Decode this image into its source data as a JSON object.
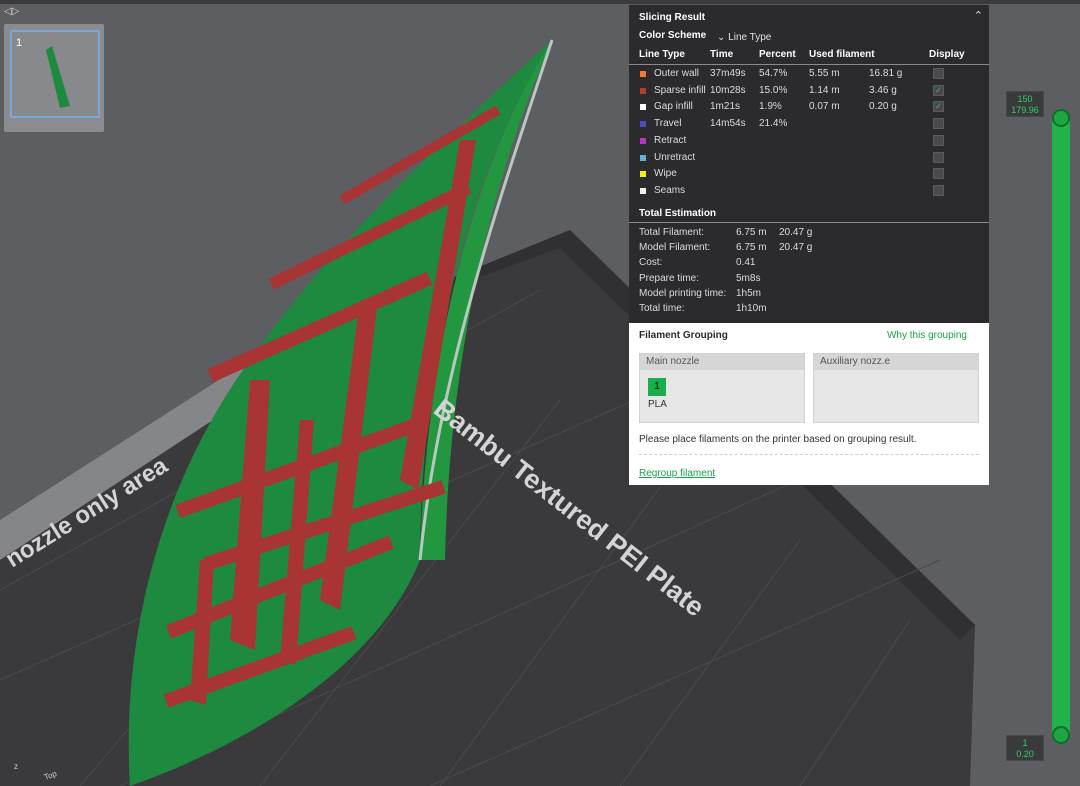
{
  "collapse_toggle_icon": "◁▷",
  "thumbnail": {
    "plate_number": "1"
  },
  "bed": {
    "nozzle_area_label": "nozzle only area",
    "plate_label": "Bambu Textured PEI Plate"
  },
  "slicing_result": {
    "title": "Slicing Result",
    "collapse_icon": "⌃",
    "color_scheme_label": "Color Scheme",
    "color_scheme_value": "⌄ Line Type",
    "headers": {
      "line_type": "Line Type",
      "time": "Time",
      "percent": "Percent",
      "used_filament": "Used filament",
      "display": "Display"
    },
    "rows": [
      {
        "name": "Outer wall",
        "color": "#f07a38",
        "time": "37m49s",
        "percent": "54.7%",
        "length": "5.55 m",
        "weight": "16.81 g",
        "checked": false
      },
      {
        "name": "Sparse infill",
        "color": "#b53a34",
        "time": "10m28s",
        "percent": "15.0%",
        "length": "1.14 m",
        "weight": "3.46 g",
        "checked": true
      },
      {
        "name": "Gap infill",
        "color": "#ffffff",
        "time": "1m21s",
        "percent": "1.9%",
        "length": "0.07 m",
        "weight": "0.20 g",
        "checked": true
      },
      {
        "name": "Travel",
        "color": "#4a4cc0",
        "time": "14m54s",
        "percent": "21.4%",
        "length": "",
        "weight": "",
        "checked": false
      },
      {
        "name": "Retract",
        "color": "#c030c8",
        "time": "",
        "percent": "",
        "length": "",
        "weight": "",
        "checked": false
      },
      {
        "name": "Unretract",
        "color": "#5fb2d8",
        "time": "",
        "percent": "",
        "length": "",
        "weight": "",
        "checked": false
      },
      {
        "name": "Wipe",
        "color": "#f4f00e",
        "time": "",
        "percent": "",
        "length": "",
        "weight": "",
        "checked": false
      },
      {
        "name": "Seams",
        "color": "#efefef",
        "time": "",
        "percent": "",
        "length": "",
        "weight": "",
        "checked": false
      }
    ],
    "total_title": "Total Estimation",
    "estimation": [
      {
        "label": "Total Filament:",
        "value": "6.75 m",
        "value2": "20.47 g"
      },
      {
        "label": "Model Filament:",
        "value": "6.75 m",
        "value2": "20.47 g"
      },
      {
        "label": "Cost:",
        "value": "0.41",
        "value2": ""
      },
      {
        "label": "Prepare time:",
        "value": "5m8s",
        "value2": ""
      },
      {
        "label": "Model printing time:",
        "value": "1h5m",
        "value2": ""
      },
      {
        "label": "Total time:",
        "value": "1h10m",
        "value2": ""
      }
    ]
  },
  "filament_grouping": {
    "title": "Filament Grouping",
    "why_link": "Why this grouping",
    "main_nozzle": "Main nozzle",
    "aux_nozzle": "Auxiliary nozz.e",
    "filament_number": "1",
    "filament_type": "PLA",
    "note": "Please place filaments on the printer based on grouping result.",
    "regroup_link": "Regroup filament"
  },
  "layer_slider": {
    "top_layer": "150",
    "top_height": "179.96",
    "bottom_layer": "1",
    "bottom_height": "0.20"
  },
  "axis": {
    "z": "z",
    "view_label": "Top"
  }
}
